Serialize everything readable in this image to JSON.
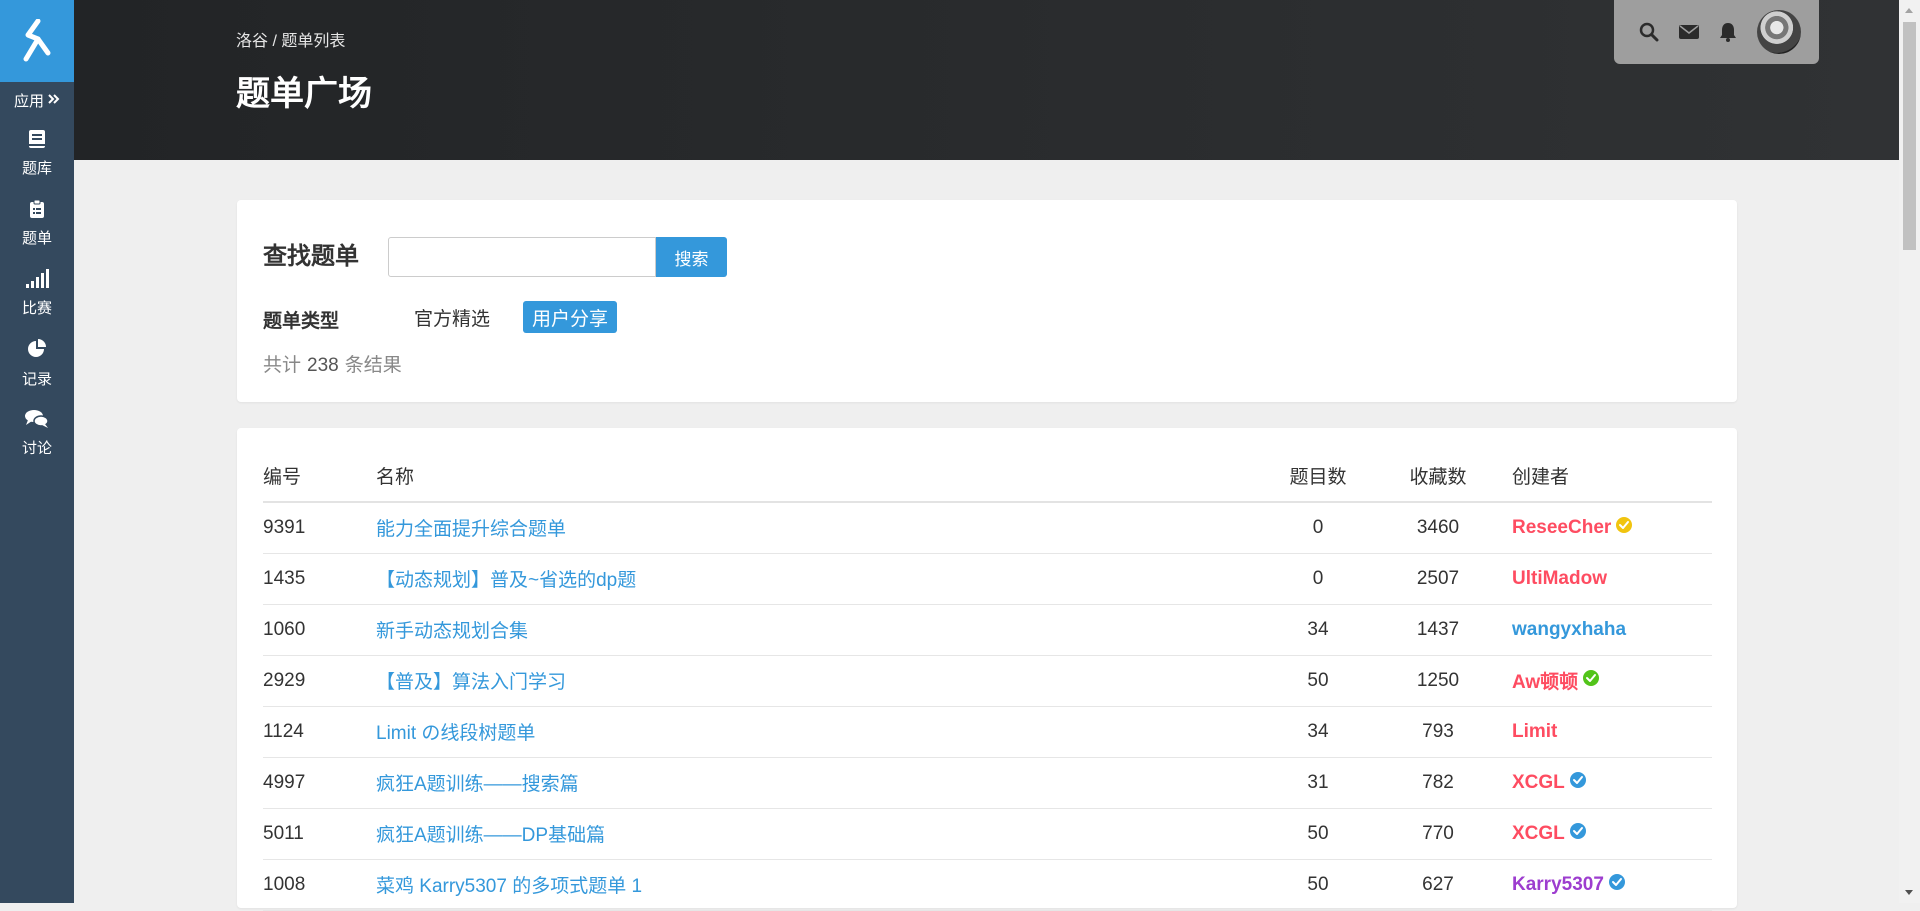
{
  "sidebar": {
    "apps_label": "应用",
    "items": [
      {
        "label": "题库",
        "icon": "book-icon"
      },
      {
        "label": "题单",
        "icon": "clipboard-icon"
      },
      {
        "label": "比赛",
        "icon": "bar-chart-icon"
      },
      {
        "label": "记录",
        "icon": "pie-chart-icon"
      },
      {
        "label": "讨论",
        "icon": "comments-icon"
      }
    ]
  },
  "header": {
    "breadcrumb": {
      "home": "洛谷",
      "separator": " / ",
      "current": "题单列表"
    },
    "title": "题单广场"
  },
  "search": {
    "label": "查找题单",
    "input_value": "",
    "button": "搜索",
    "type_label": "题单类型",
    "type_options": [
      "官方精选",
      "用户分享"
    ],
    "selected_type": "用户分享",
    "total_prefix": "共计",
    "total_count": "238",
    "total_suffix": "条结果"
  },
  "table": {
    "headers": {
      "id": "编号",
      "name": "名称",
      "problems": "题目数",
      "favorites": "收藏数",
      "creator": "创建者"
    },
    "rows": [
      {
        "id": "9391",
        "name": "能力全面提升综合题单",
        "problems": "0",
        "favorites": "3460",
        "creator": "ReseeCher",
        "creator_color": "#fe4c61",
        "badge": "#f1c40f"
      },
      {
        "id": "1435",
        "name": "【动态规划】普及~省选的dp题",
        "problems": "0",
        "favorites": "2507",
        "creator": "UltiMadow",
        "creator_color": "#fe4c61",
        "badge": ""
      },
      {
        "id": "1060",
        "name": "新手动态规划合集",
        "problems": "34",
        "favorites": "1437",
        "creator": "wangyxhaha",
        "creator_color": "#3498db",
        "badge": ""
      },
      {
        "id": "2929",
        "name": "【普及】算法入门学习",
        "problems": "50",
        "favorites": "1250",
        "creator": "Aw顿顿",
        "creator_color": "#fe4c61",
        "badge": "#52c41a"
      },
      {
        "id": "1124",
        "name": "Limit の线段树题单",
        "problems": "34",
        "favorites": "793",
        "creator": "Limit",
        "creator_color": "#fe4c61",
        "badge": ""
      },
      {
        "id": "4997",
        "name": "疯狂A题训练——搜索篇",
        "problems": "31",
        "favorites": "782",
        "creator": "XCGL",
        "creator_color": "#fe4c61",
        "badge": "#3498db"
      },
      {
        "id": "5011",
        "name": "疯狂A题训练——DP基础篇",
        "problems": "50",
        "favorites": "770",
        "creator": "XCGL",
        "creator_color": "#fe4c61",
        "badge": "#3498db"
      },
      {
        "id": "1008",
        "name": "菜鸡 Karry5307 的多项式题单 1",
        "problems": "50",
        "favorites": "627",
        "creator": "Karry5307",
        "creator_color": "#9d3dcf",
        "badge": "#3498db"
      }
    ]
  }
}
